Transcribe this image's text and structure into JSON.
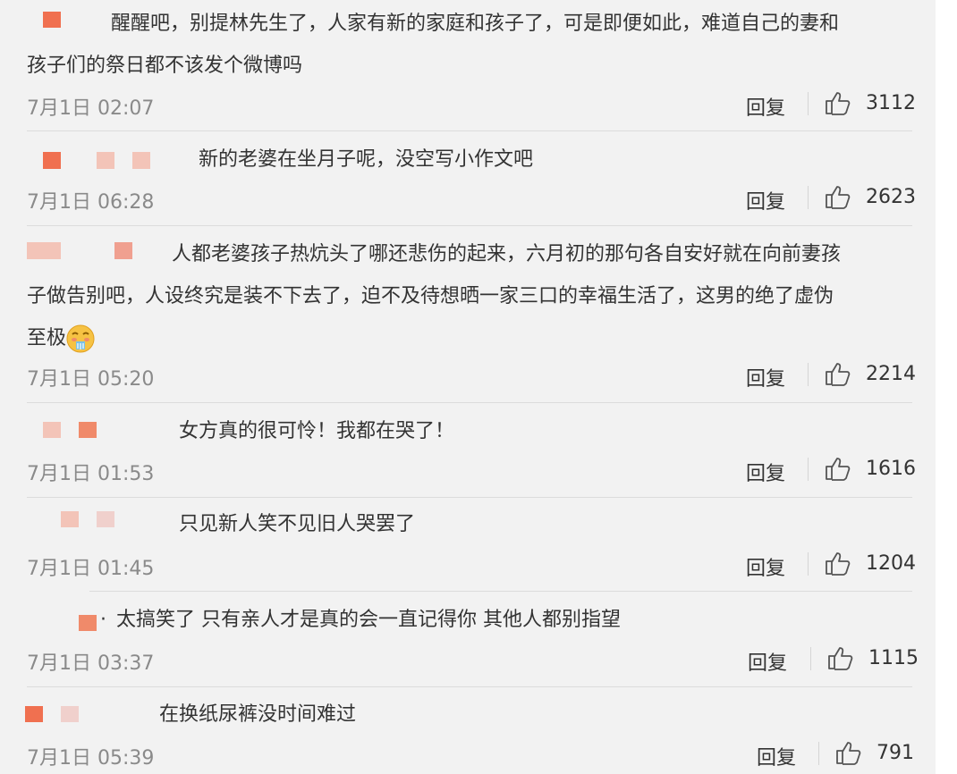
{
  "comments": [
    {
      "line1": "醒醒吧，别提林先生了，人家有新的家庭和孩子了，可是即便如此，难道自己的妻和",
      "line2": "孩子们的祭日都不该发个微博吗",
      "time": "7月1日 02:07",
      "reply": "回复",
      "likes": "3112"
    },
    {
      "line1": "新的老婆在坐月子呢，没空写小作文吧",
      "time": "7月1日 06:28",
      "reply": "回复",
      "likes": "2623"
    },
    {
      "line1": "人都老婆孩子热炕头了哪还悲伤的起来，六月初的那句各自安好就在向前妻孩",
      "line2": "子做告别吧，人设终究是装不下去了，迫不及待想晒一家三口的幸福生活了，这男的绝了虚伪",
      "line3": "至极",
      "emoji": "vomit-emoji",
      "time": "7月1日 05:20",
      "reply": "回复",
      "likes": "2214"
    },
    {
      "line1": "女方真的很可怜！我都在哭了！",
      "time": "7月1日 01:53",
      "reply": "回复",
      "likes": "1616"
    },
    {
      "line1": "只见新人笑不见旧人哭罢了",
      "time": "7月1日 01:45",
      "reply": "回复",
      "likes": "1204"
    },
    {
      "line1": "太搞笑了 只有亲人才是真的会一直记得你 其他人都别指望",
      "time": "7月1日 03:37",
      "reply": "回复",
      "likes": "1115"
    },
    {
      "line1": "在换纸尿裤没时间难过",
      "time": "7月1日 05:39",
      "reply": "回复",
      "likes": "791"
    }
  ],
  "icons": {
    "like": "thumbs-up-icon"
  },
  "colors": {
    "redacted_strong": "#f07050",
    "redacted_light": "#f3c4b8",
    "redacted_pale": "#f0d0cc"
  }
}
